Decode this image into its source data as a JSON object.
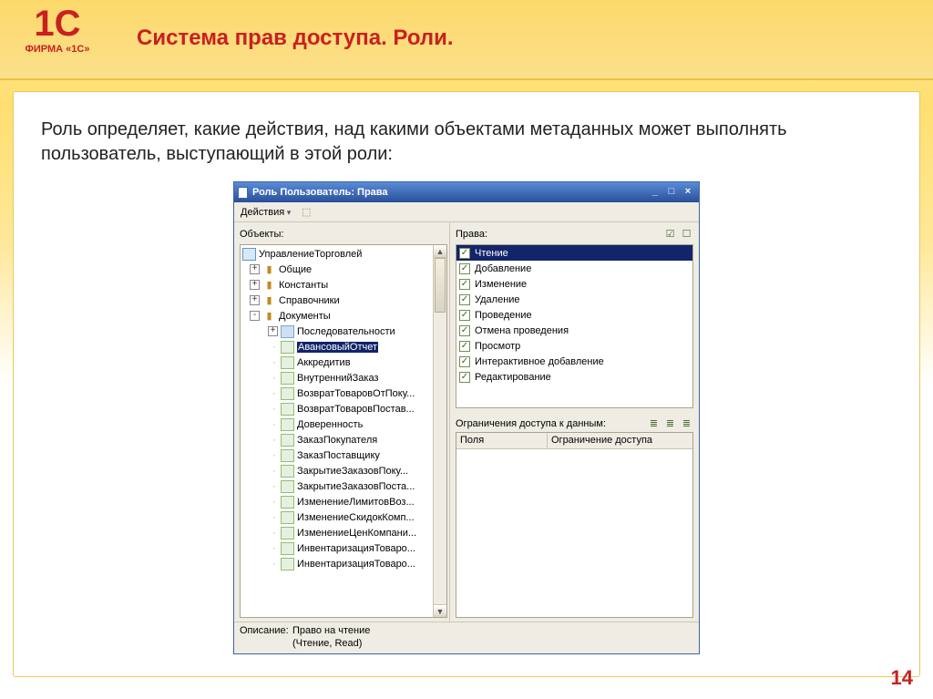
{
  "logo": {
    "mark": "1C",
    "caption": "ФИРМА «1С»"
  },
  "slide": {
    "title": "Система прав доступа. Роли.",
    "intro": "Роль определяет, какие действия, над какими объектами метаданных может выполнять пользователь, выступающий в этой роли:",
    "page": "14"
  },
  "window": {
    "title": "Роль Пользователь: Права",
    "toolbar": {
      "actions": "Действия"
    },
    "left_label": "Объекты:",
    "right_label": "Права:",
    "restrict_label": "Ограничения доступа к данным:",
    "grid": {
      "col1": "Поля",
      "col2": "Ограничение доступа"
    },
    "desc_label": "Описание:",
    "desc_text": "Право на чтение\n(Чтение, Read)"
  },
  "tree": {
    "root": "УправлениеТорговлей",
    "groups": [
      {
        "exp": "+",
        "label": "Общие"
      },
      {
        "exp": "+",
        "label": "Константы"
      },
      {
        "exp": "+",
        "label": "Справочники"
      },
      {
        "exp": "-",
        "label": "Документы"
      }
    ],
    "docs": [
      {
        "label": "Последовательности",
        "kind": "seq"
      },
      {
        "label": "АвансовыйОтчет",
        "selected": true
      },
      {
        "label": "Аккредитив"
      },
      {
        "label": "ВнутреннийЗаказ"
      },
      {
        "label": "ВозвратТоваровОтПоку..."
      },
      {
        "label": "ВозвратТоваровПостав..."
      },
      {
        "label": "Доверенность"
      },
      {
        "label": "ЗаказПокупателя"
      },
      {
        "label": "ЗаказПоставщику"
      },
      {
        "label": "ЗакрытиеЗаказовПоку..."
      },
      {
        "label": "ЗакрытиеЗаказовПоста..."
      },
      {
        "label": "ИзменениеЛимитовВоз..."
      },
      {
        "label": "ИзменениеСкидокКомп..."
      },
      {
        "label": "ИзменениеЦенКомпани..."
      },
      {
        "label": "ИнвентаризацияТоваро..."
      },
      {
        "label": "ИнвентаризацияТоваро..."
      }
    ]
  },
  "rights": [
    {
      "label": "Чтение",
      "checked": true,
      "selected": true
    },
    {
      "label": "Добавление",
      "checked": true
    },
    {
      "label": "Изменение",
      "checked": true
    },
    {
      "label": "Удаление",
      "checked": true
    },
    {
      "label": "Проведение",
      "checked": true
    },
    {
      "label": "Отмена проведения",
      "checked": true
    },
    {
      "label": "Просмотр",
      "checked": true
    },
    {
      "label": "Интерактивное добавление",
      "checked": true
    },
    {
      "label": "Редактирование",
      "checked": true
    }
  ]
}
